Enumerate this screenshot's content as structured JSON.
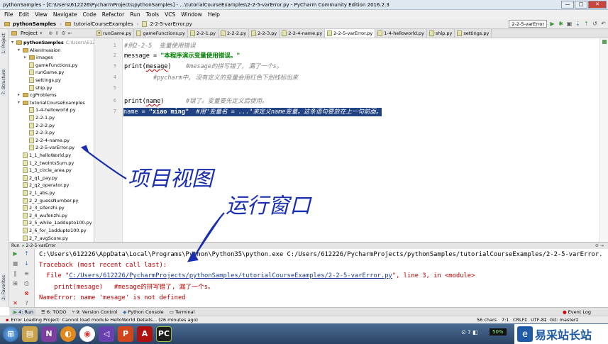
{
  "window": {
    "title": "pythonSamples - [C:\\Users\\612226\\PycharmProjects\\pythonSamples] - ...\\tutorialCourseExamples\\2-2-5-varError.py - PyCharm Community Edition 2016.2.3",
    "controls": [
      "—",
      "□",
      "✕"
    ]
  },
  "menu": [
    "File",
    "Edit",
    "View",
    "Navigate",
    "Code",
    "Refactor",
    "Run",
    "Tools",
    "VCS",
    "Window",
    "Help"
  ],
  "breadcrumb": [
    "pythonSamples",
    "tutorialCourseExamples",
    "2-2-5-varError.py"
  ],
  "run_config": {
    "selected": "2-2-5-varError"
  },
  "side_tabs": {
    "project": "1: Project",
    "structure": "7: Structure",
    "favorites": "2: Favorites"
  },
  "project_panel": {
    "title": "Project"
  },
  "tabs": [
    {
      "label": "runGame.py",
      "active": false
    },
    {
      "label": "gameFunctions.py",
      "active": false
    },
    {
      "label": "2-2-1.py",
      "active": false
    },
    {
      "label": "2-2-2.py",
      "active": false
    },
    {
      "label": "2-2-3.py",
      "active": false
    },
    {
      "label": "2-2-4-name.py",
      "active": false
    },
    {
      "label": "2-2-5-varError.py",
      "active": true
    },
    {
      "label": "1-4-helloworld.py",
      "active": false
    },
    {
      "label": "ship.py",
      "active": false
    },
    {
      "label": "settings.py",
      "active": false
    }
  ],
  "tree": [
    {
      "label": "pythonSamples",
      "extra": "C:\\Users\\612",
      "level": 0,
      "type": "folder",
      "open": true
    },
    {
      "label": "AlienInvasion",
      "level": 1,
      "type": "folder",
      "open": true
    },
    {
      "label": "images",
      "level": 2,
      "type": "folder",
      "open": false
    },
    {
      "label": "gameFunctions.py",
      "level": 2,
      "type": "file"
    },
    {
      "label": "runGame.py",
      "level": 2,
      "type": "file"
    },
    {
      "label": "settings.py",
      "level": 2,
      "type": "file"
    },
    {
      "label": "ship.py",
      "level": 2,
      "type": "file"
    },
    {
      "label": "cgProblems",
      "level": 1,
      "type": "folder",
      "open": false
    },
    {
      "label": "tutorialCourseExamples",
      "level": 1,
      "type": "folder",
      "open": true
    },
    {
      "label": "1-4-helloworld.py",
      "level": 2,
      "type": "file"
    },
    {
      "label": "2-2-1.py",
      "level": 2,
      "type": "file"
    },
    {
      "label": "2-2-2.py",
      "level": 2,
      "type": "file"
    },
    {
      "label": "2-2-3.py",
      "level": 2,
      "type": "file"
    },
    {
      "label": "2-2-4-name.py",
      "level": 2,
      "type": "file"
    },
    {
      "label": "2-2-5-varError.py",
      "level": 2,
      "type": "file"
    },
    {
      "label": "1_1_helloWorld.py",
      "level": 1,
      "type": "file"
    },
    {
      "label": "1_2_twoIntsSum.py",
      "level": 1,
      "type": "file"
    },
    {
      "label": "1_3_circle_area.py",
      "level": 1,
      "type": "file"
    },
    {
      "label": "2_q1_pay.py",
      "level": 1,
      "type": "file"
    },
    {
      "label": "2_q2_operator.py",
      "level": 1,
      "type": "file"
    },
    {
      "label": "2_1_abs.py",
      "level": 1,
      "type": "file"
    },
    {
      "label": "2_2_guessNumber.py",
      "level": 1,
      "type": "file"
    },
    {
      "label": "2_3_sifenzhi.py",
      "level": 1,
      "type": "file"
    },
    {
      "label": "2_4_wufenzhi.py",
      "level": 1,
      "type": "file"
    },
    {
      "label": "2_5_while_1addupto100.py",
      "level": 1,
      "type": "file"
    },
    {
      "label": "2_6_for_1addupto100.py",
      "level": 1,
      "type": "file"
    },
    {
      "label": "2_7_avgScore.py",
      "level": 1,
      "type": "file"
    }
  ],
  "line_numbers": [
    "1",
    "2",
    "3",
    "4",
    "5",
    "6",
    "7"
  ],
  "code": {
    "l1": "#例2-2-5  变量使用错误",
    "l2a": "message = ",
    "l2b": "\"本程序演示变量使用错误。\"",
    "l3a": "print(",
    "l3b": "mesage",
    "l3c": ")    ",
    "l3d": "#mesage的拼写错了, 漏了一个s。",
    "l4": "        #pycharm中, 没有定义的变量会用红色下划线标出来",
    "l6a": "print(",
    "l6b": "name",
    "l6c": ")      ",
    "l6d": "#错了。变量要先定义后使用。",
    "l7a": "name = ",
    "l7b": "\"xiao ming\"",
    "l7c": "  #用\"变量名 = ...\"来定义name变量。这条语句要放在上一句前面。"
  },
  "run_panel": {
    "title": "Run",
    "config": "2-2-5-varError"
  },
  "console": {
    "c1": "C:\\Users\\612226\\AppData\\Local\\Programs\\Python\\Python35\\python.exe C:/Users/612226/PycharmProjects/pythonSamples/tutorialCourseExamples/2-2-5-varError.",
    "c2": "Traceback (most recent call last):",
    "c3a": "  File \"",
    "c3b": "C:/Users/612226/PycharmProjects/pythonSamples/tutorialCourseExamples/2-2-5-varError.py",
    "c3c": "\", line 3, in <module>",
    "c4": "    print(mesage)   #mesage的拼写错了, 漏了一个s。",
    "c5": "NameError: name 'mesage' is not defined"
  },
  "bottom_tabs": [
    "4: Run",
    "6: TODO",
    "9: Version Control",
    "Python Console",
    "Terminal"
  ],
  "event_log": "Event Log",
  "status": {
    "message": "Error Loading Project: Cannot load module HelloWorld Details... (26 minutes ago)",
    "chars": "56 chars",
    "pos": "7:1",
    "crlf": "CRLF‡",
    "enc": "UTF-8‡",
    "git": "Git: master‡"
  },
  "taskbar": {
    "apps": [
      "start",
      "file-explorer",
      "onenote",
      "media",
      "chrome",
      "visual-studio",
      "powerpoint",
      "pdf",
      "pycharm"
    ],
    "tray_percent": "50%"
  },
  "watermark": {
    "text": "易采站长站"
  },
  "annotations": {
    "project_view": "项目视图",
    "run_window": "运行窗口"
  }
}
